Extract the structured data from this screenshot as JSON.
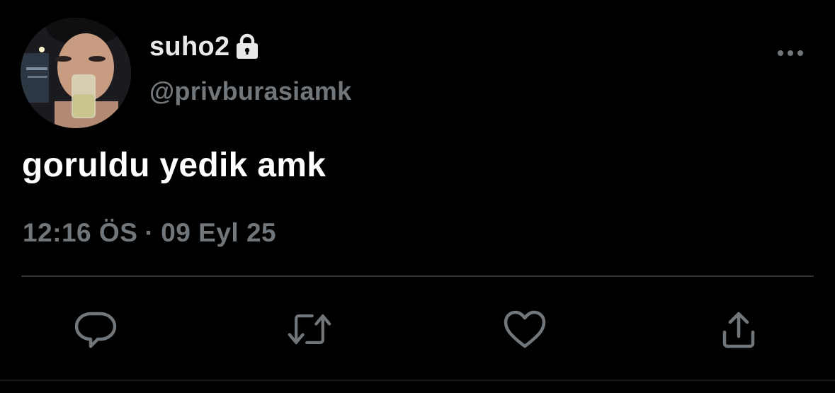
{
  "user": {
    "display_name": "suho2",
    "handle": "@privburasiamk",
    "protected_icon": "lock-icon",
    "avatar": "profile-photo"
  },
  "tweet": {
    "text": "goruldu yedik amk",
    "time": "12:16 ÖS",
    "separator": "·",
    "date": "09 Eyl 25"
  },
  "actions": [
    {
      "icon": "reply-icon"
    },
    {
      "icon": "retweet-icon"
    },
    {
      "icon": "like-icon"
    },
    {
      "icon": "share-icon"
    }
  ],
  "colors": {
    "background": "#000000",
    "primary_text": "#e7e9ea",
    "secondary_text": "#71767b",
    "divider": "#2f3336"
  }
}
